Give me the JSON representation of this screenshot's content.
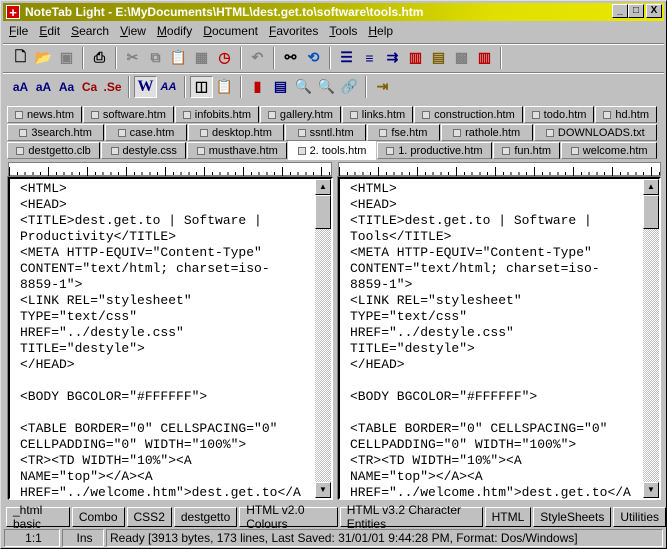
{
  "window": {
    "title": "NoteTab Light  -  E:\\MyDocuments\\HTML\\dest.get.to\\software\\tools.htm",
    "minimize": "_",
    "maximize": "□",
    "close": "X"
  },
  "menu": [
    {
      "label": "File",
      "key": "F",
      "rest": "ile"
    },
    {
      "label": "Edit",
      "key": "E",
      "rest": "dit"
    },
    {
      "label": "Search",
      "key": "S",
      "rest": "earch"
    },
    {
      "label": "View",
      "key": "V",
      "rest": "iew"
    },
    {
      "label": "Modify",
      "key": "M",
      "rest": "odify"
    },
    {
      "label": "Document",
      "key": "D",
      "rest": "ocument"
    },
    {
      "label": "Favorites",
      "key": "F",
      "rest": "avorites"
    },
    {
      "label": "Tools",
      "key": "T",
      "rest": "ools"
    },
    {
      "label": "Help",
      "key": "H",
      "rest": "elp"
    }
  ],
  "toolbar1": [
    "new-file",
    "open-folder",
    "save",
    "print",
    "cut",
    "copy",
    "paste",
    "paste-special",
    "clock",
    "undo",
    "find",
    "replace",
    "bullet-list",
    "numbered-list",
    "align",
    "ruler-red",
    "document-bars",
    "paste-disabled",
    "ruler-red-2"
  ],
  "toolbar2": {
    "labels": [
      "aA",
      "aA",
      "Aa",
      "Ca",
      ".Se",
      "W",
      "AA"
    ]
  },
  "tabs": {
    "row1": [
      "news.htm",
      "software.htm",
      "infobits.htm",
      "gallery.htm",
      "links.htm",
      "construction.htm",
      "todo.htm",
      "hd.htm"
    ],
    "row2": [
      "3search.htm",
      "case.htm",
      "desktop.htm",
      "ssntl.htm",
      "fse.htm",
      "rathole.htm",
      "DOWNLOADS.txt"
    ],
    "row3": [
      "destgetto.clb",
      "destyle.css",
      "musthave.htm",
      "2. tools.htm",
      "1. productive.htm",
      "fun.htm",
      "welcome.htm"
    ],
    "active": "2. tools.htm"
  },
  "editor": {
    "left": "<HTML>\n<HEAD>\n<TITLE>dest.get.to | Software |\nProductivity</TITLE>\n<META HTTP-EQUIV=\"Content-Type\"\nCONTENT=\"text/html; charset=iso-\n8859-1\">\n<LINK REL=\"stylesheet\"\nTYPE=\"text/css\"\nHREF=\"../destyle.css\"\nTITLE=\"destyle\">\n</HEAD>\n\n<BODY BGCOLOR=\"#FFFFFF\">\n\n<TABLE BORDER=\"0\" CELLSPACING=\"0\"\nCELLPADDING=\"0\" WIDTH=\"100%\">\n<TR><TD WIDTH=\"10%\"><A\nNAME=\"top\"></A><A\nHREF=\"../welcome.htm\">dest.get.to</A",
    "right": "<HTML>\n<HEAD>\n<TITLE>dest.get.to | Software |\nTools</TITLE>\n<META HTTP-EQUIV=\"Content-Type\"\nCONTENT=\"text/html; charset=iso-\n8859-1\">\n<LINK REL=\"stylesheet\"\nTYPE=\"text/css\"\nHREF=\"../destyle.css\"\nTITLE=\"destyle\">\n</HEAD>\n\n<BODY BGCOLOR=\"#FFFFFF\">\n\n<TABLE BORDER=\"0\" CELLSPACING=\"0\"\nCELLPADDING=\"0\" WIDTH=\"100%\">\n<TR><TD WIDTH=\"10%\"><A\nNAME=\"top\"></A><A\nHREF=\"../welcome.htm\">dest.get.to</A"
  },
  "cliplibs": [
    "_html basic",
    "Combo",
    "CSS2",
    "destgetto",
    "HTML v2.0 Colours",
    "HTML v3.2 Character Entities",
    "HTML",
    "StyleSheets",
    "Utilities"
  ],
  "status": {
    "position": "1:1",
    "mode": "Ins",
    "message": "Ready  [3913 bytes, 173 lines, Last Saved: 31/01/01 9:44:28 PM, Format: Dos/Windows]"
  },
  "colors": {
    "titlebar_start": "#8a8a00",
    "titlebar_end": "#e8e800",
    "face": "#c0c0c0"
  }
}
